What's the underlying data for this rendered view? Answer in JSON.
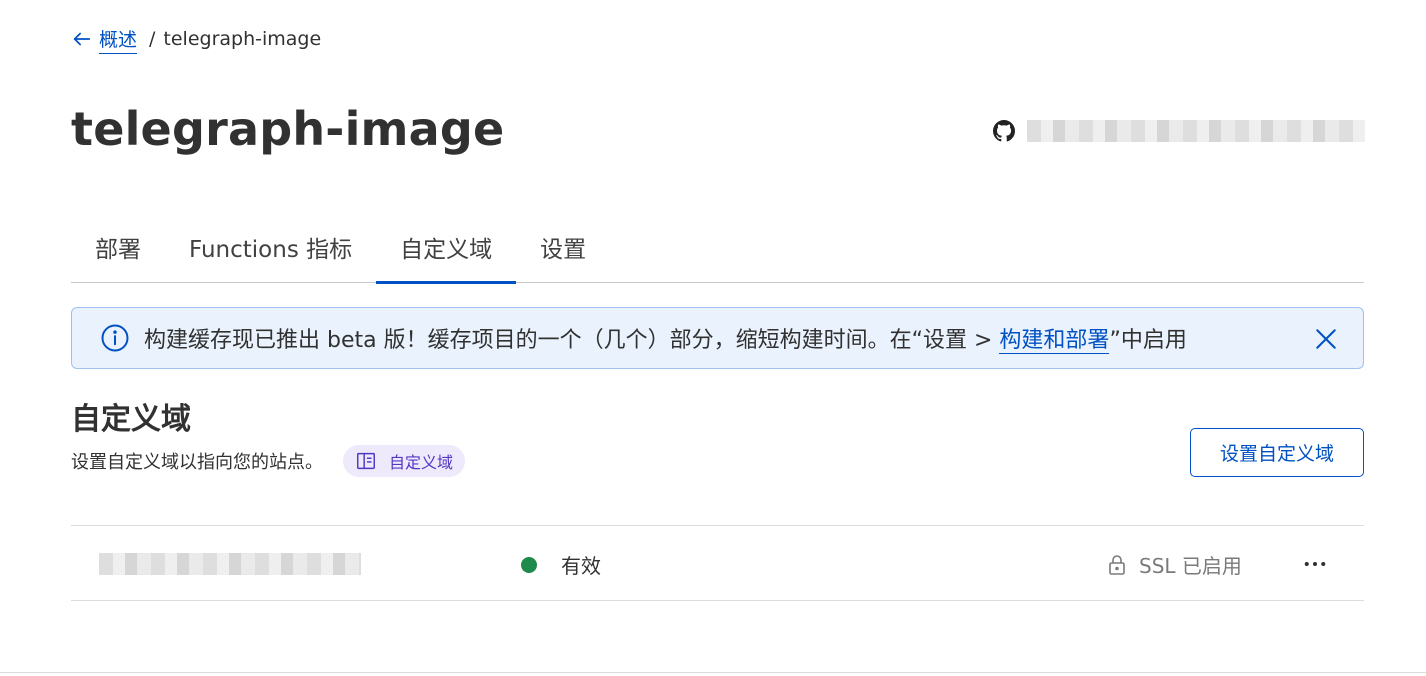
{
  "breadcrumb": {
    "back_label": "概述",
    "separator": "/",
    "current": "telegraph-image"
  },
  "project": {
    "title": "telegraph-image",
    "repo_icon": "github-icon"
  },
  "tabs": [
    {
      "label": "部署",
      "active": false
    },
    {
      "label": "Functions 指标",
      "active": false
    },
    {
      "label": "自定义域",
      "active": true
    },
    {
      "label": "设置",
      "active": false
    }
  ],
  "banner": {
    "icon": "info-icon",
    "text_before": "构建缓存现已推出 beta 版！缓存项目的一个（几个）部分，缩短构建时间。在“设置 > ",
    "link_text": "构建和部署",
    "text_after": "”中启用",
    "close_icon": "close-icon"
  },
  "section": {
    "title": "自定义域",
    "description": "设置自定义域以指向您的站点。",
    "doc_link_label": "自定义域",
    "doc_icon": "book-icon",
    "primary_button": "设置自定义域"
  },
  "domains": [
    {
      "status": "有效",
      "ssl": "SSL 已启用"
    }
  ],
  "colors": {
    "accent": "#0051c3",
    "status_active": "#1e8a4c",
    "banner_bg": "#eaf3fd",
    "pill_bg": "#eee9fb"
  }
}
